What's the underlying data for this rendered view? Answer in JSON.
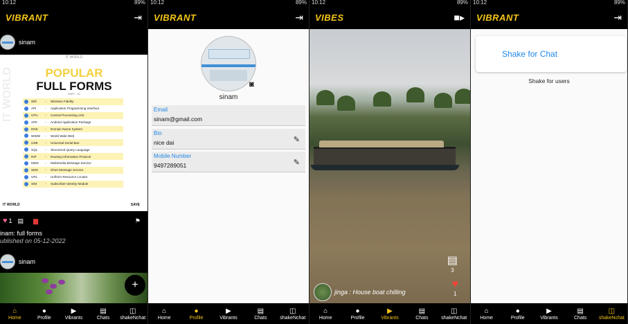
{
  "status": {
    "time": "10:12",
    "battery": "89%"
  },
  "nav": [
    {
      "label": "Home",
      "icon": "home-icon",
      "glyph": "⌂"
    },
    {
      "label": "Profile",
      "icon": "person-icon",
      "glyph": "●"
    },
    {
      "label": "Vibrants",
      "icon": "video-icon",
      "glyph": "▶"
    },
    {
      "label": "Chats",
      "icon": "chat-icon",
      "glyph": "▤"
    },
    {
      "label": "shakeNchat",
      "icon": "vibrate-icon",
      "glyph": "◫"
    }
  ],
  "screen1": {
    "app_title": "VIBRANT",
    "post_user": "sinam",
    "poster": {
      "brand": "IT WORLD",
      "side_text": "IT WORLD",
      "heading1": "POPULAR",
      "heading2": "FULL FORMS",
      "part": "PART - 01",
      "rows": [
        {
          "abbr": "Wifi",
          "full": "Wireless Fidelity"
        },
        {
          "abbr": "API",
          "full": "Application Programming Interface"
        },
        {
          "abbr": "CPU",
          "full": "Central Processing Unit"
        },
        {
          "abbr": "APK",
          "full": "Android Application Package"
        },
        {
          "abbr": "DNS",
          "full": "Domain Name System"
        },
        {
          "abbr": "WWW",
          "full": "World Wide Web"
        },
        {
          "abbr": "USB",
          "full": "Universal Serial Bus"
        },
        {
          "abbr": "SQL",
          "full": "Structured Query Language"
        },
        {
          "abbr": "RIP",
          "full": "Routing Information Protocol"
        },
        {
          "abbr": "MMS",
          "full": "Multimedia Message Service"
        },
        {
          "abbr": "SMS",
          "full": "Short Message Service"
        },
        {
          "abbr": "URL",
          "full": "Uniform Resource Locator"
        },
        {
          "abbr": "SIM",
          "full": "Subscriber Identity Module"
        }
      ],
      "footer_left": "IT WORLD",
      "footer_right": "SAVE"
    },
    "like_count": "1",
    "caption": "inam: full forms",
    "published": "ublished on 05-12-2022",
    "second_user": "sinam",
    "fab": "+"
  },
  "screen2": {
    "app_title": "VIBRANT",
    "name": "sinam",
    "email_label": "Email",
    "email": "sinam@gmail.com",
    "bio_label": "Bio",
    "bio": "nice dai",
    "mobile_label": "Mobile Number",
    "mobile": "9497289051"
  },
  "screen3": {
    "app_title": "VIBES",
    "comment_count": "3",
    "like_count": "1",
    "caption": "jinga : House boat chilling"
  },
  "screen4": {
    "app_title": "VIBRANT",
    "shake_button": "Shake for Chat",
    "shake_users": "Shake for users"
  },
  "active_tabs": [
    "Home",
    "Profile",
    "Vibrants",
    "shakeNchat"
  ],
  "colors": {
    "accent": "#f5c518",
    "link": "#1e88e5",
    "like": "#f44336"
  }
}
